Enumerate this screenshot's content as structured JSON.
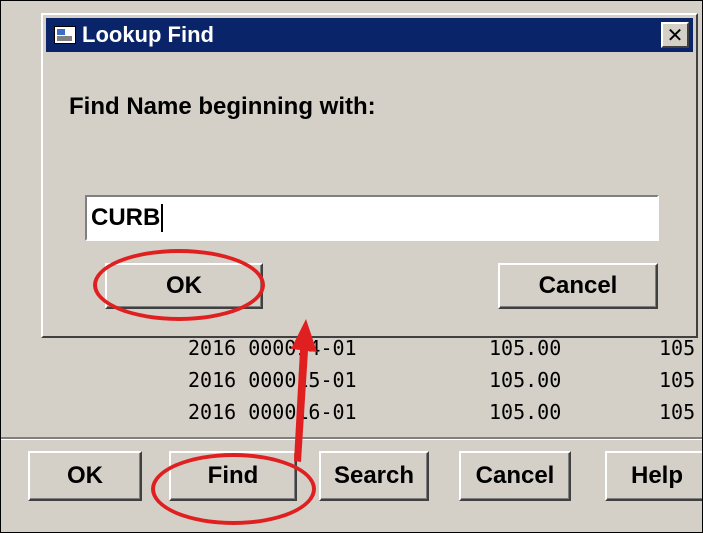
{
  "dialog": {
    "title": "Lookup Find",
    "close_symbol": "✕",
    "prompt": "Find Name beginning with:",
    "input_value": "CURB",
    "ok_label": "OK",
    "cancel_label": "Cancel"
  },
  "list": {
    "rows": [
      {
        "id": "2016 000014-01",
        "amount1": "105.00",
        "amount2": "105"
      },
      {
        "id": "2016 000015-01",
        "amount1": "105.00",
        "amount2": "105"
      },
      {
        "id": "2016 000016-01",
        "amount1": "105.00",
        "amount2": "105"
      }
    ]
  },
  "toolbar": {
    "ok_label": "OK",
    "find_label": "Find",
    "search_label": "Search",
    "cancel_label": "Cancel",
    "help_label": "Help"
  },
  "annotation": {
    "color": "#e02020",
    "icons": [
      "ellipse-highlight",
      "arrow"
    ]
  }
}
